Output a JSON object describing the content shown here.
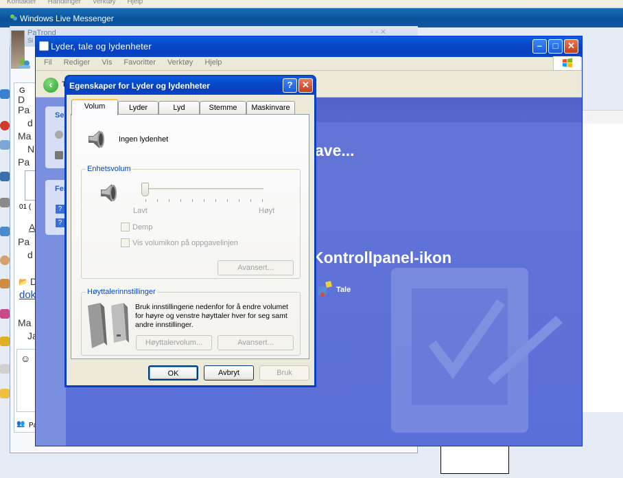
{
  "background": {
    "top_menu": [
      "Kontakter",
      "Handlinger",
      "Verktøy",
      "Hjelp"
    ],
    "messenger_title": "Windows Live Messenger",
    "chat": {
      "contact_name": "PaTrond",
      "contact_status": "Sl",
      "left_fragments": [
        "D",
        "Pa",
        "d",
        "Ma",
        "N",
        "Pa",
        "01 (",
        "A",
        "Pa",
        "d",
        "D",
        "dok",
        "Ma",
        "Ja",
        "Pa"
      ],
      "left_labels": [
        "G",
        "Se",
        "Fei",
        "T"
      ]
    }
  },
  "explorer": {
    "title": "Lyder, tale og lydenheter",
    "menu": [
      "Fil",
      "Rediger",
      "Vis",
      "Favoritter",
      "Verktøy",
      "Hjelp"
    ],
    "heading_task": "ave...",
    "heading_icon": "Kontrollpanel-ikon",
    "icon_tale": "Tale"
  },
  "dialog": {
    "title": "Egenskaper for Lyder og lydenheter",
    "help_glyph": "?",
    "close_glyph": "✕",
    "tabs": [
      "Volum",
      "Lyder",
      "Lyd",
      "Stemme",
      "Maskinvare"
    ],
    "active_tab": "Volum",
    "device_name": "Ingen lydenhet",
    "device_volume_group": "Enhetsvolum",
    "slider_min_label": "Lavt",
    "slider_max_label": "Høyt",
    "slider_value": 0,
    "mute_label": "Demp",
    "taskbar_icon_label": "Vis volumikon på oppgavelinjen",
    "advanced_label": "Avansert...",
    "speaker_group": "Høyttalerinnstillinger",
    "speaker_desc": "Bruk innstillingene nedenfor for å endre volumet for høyre og venstre høyttaler hver for seg samt andre innstillinger.",
    "speaker_volume_label": "Høyttalervolum...",
    "speaker_advanced_label": "Avansert...",
    "ok_label": "OK",
    "cancel_label": "Avbryt",
    "apply_label": "Bruk"
  },
  "colors": {
    "xp_title_blue": "#0a3fbf",
    "cp_content_blue": "#5a6fd8",
    "tab_highlight": "#ffc83c",
    "link_blue": "#0046d5"
  }
}
